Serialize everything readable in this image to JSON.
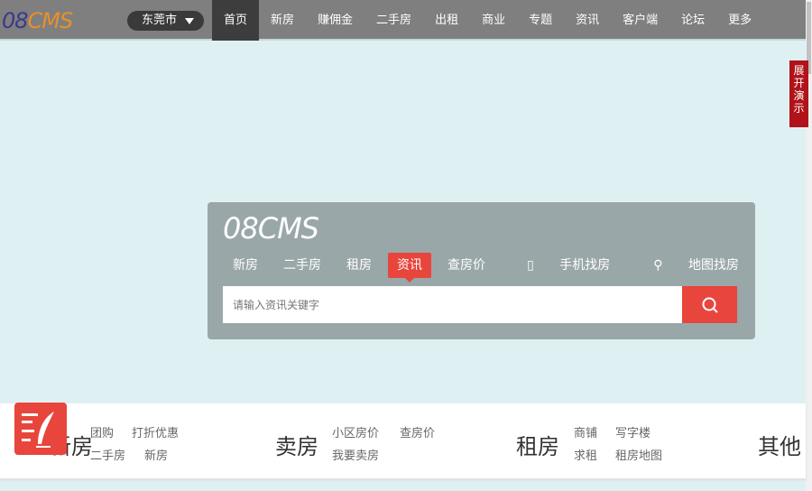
{
  "header": {
    "logo": {
      "part1": "08",
      "part2": "CMS"
    },
    "city": "东莞市",
    "nav": [
      "首页",
      "新房",
      "赚佣金",
      "二手房",
      "出租",
      "商业",
      "专题",
      "资讯",
      "客户端",
      "论坛",
      "更多"
    ],
    "active_nav": "首页"
  },
  "demo_tab": "展开演示",
  "search": {
    "logo": "08CMS",
    "tabs": [
      "新房",
      "二手房",
      "租房",
      "资讯",
      "查房价"
    ],
    "active_tab": "资讯",
    "mobile": "手机找房",
    "map": "地图找房",
    "placeholder": "请输入资讯关键字"
  },
  "sections": [
    {
      "title": "新房",
      "links": [
        "团购",
        "打折优惠",
        "二手房",
        "新房"
      ]
    },
    {
      "title": "卖房",
      "links": [
        "小区房价",
        "查房价",
        "我要卖房"
      ]
    },
    {
      "title": "租房",
      "links": [
        "商铺",
        "写字楼",
        "求租",
        "租房地图"
      ]
    },
    {
      "title": "其他",
      "links": []
    }
  ],
  "colors": {
    "accent": "#e8453c",
    "topbar": "#7f7f7f",
    "demo": "#b0141a"
  }
}
